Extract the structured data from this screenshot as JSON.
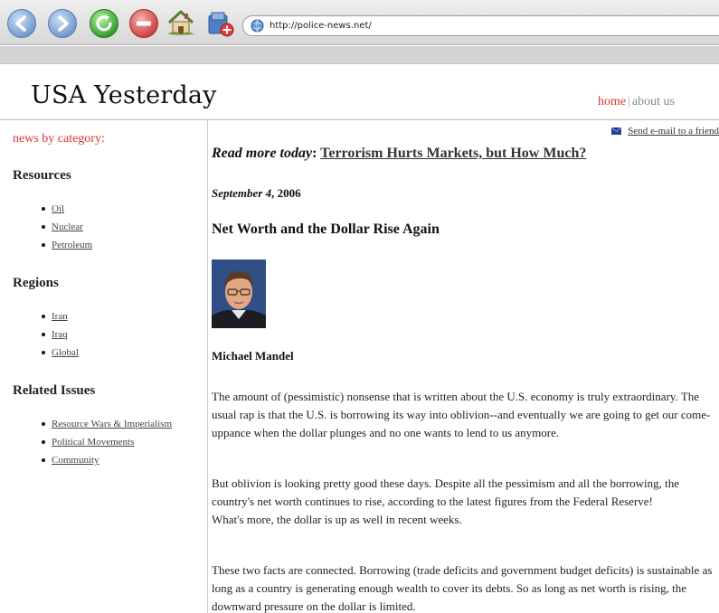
{
  "browser": {
    "url": "http://police-news.net/"
  },
  "site": {
    "title": "USA Yesterday",
    "nav": {
      "home": "home",
      "separator": "|",
      "about": "about us"
    }
  },
  "sidebar": {
    "category_title": "news by category:",
    "sections": [
      {
        "heading": "Resources",
        "items": [
          "Oil",
          "Nuclear",
          "Petroleum"
        ]
      },
      {
        "heading": "Regions",
        "items": [
          "Iran",
          "Iraq",
          "Global"
        ]
      },
      {
        "heading": "Related Issues",
        "items": [
          "Resource Wars & Imperialism",
          "Political Movements",
          "Community"
        ]
      }
    ]
  },
  "main": {
    "send_email": "Send e-mail to a friend",
    "read_more_label": "Read more today",
    "read_more_colon": ":",
    "read_more_link": "Terrorism Hurts Markets, but How Much?",
    "date_italic": "September 4",
    "date_rest": ", 2006",
    "headline": "Net Worth and the Dollar Rise Again",
    "author": "Michael Mandel",
    "paragraphs": [
      "The amount of (pessimistic) nonsense that is written about the U.S. economy is truly extraordinary. The usual rap is that the U.S. is borrowing its way into oblivion--and eventually we are going to get our come-uppance when the dollar plunges and no one wants to lend to us anymore.",
      "But oblivion is looking pretty good these days. Despite all the pessimism and all the borrowing, the country's net worth continues to rise, according to the latest figures from the Federal Reserve!",
      "What's more, the dollar is up as well in recent weeks.",
      "These two facts are connected. Borrowing (trade deficits and government budget deficits) is sustainable as long as a country is generating enough wealth to cover its debts. So as long as net worth is rising, the downward pressure on the dollar is limited."
    ]
  }
}
